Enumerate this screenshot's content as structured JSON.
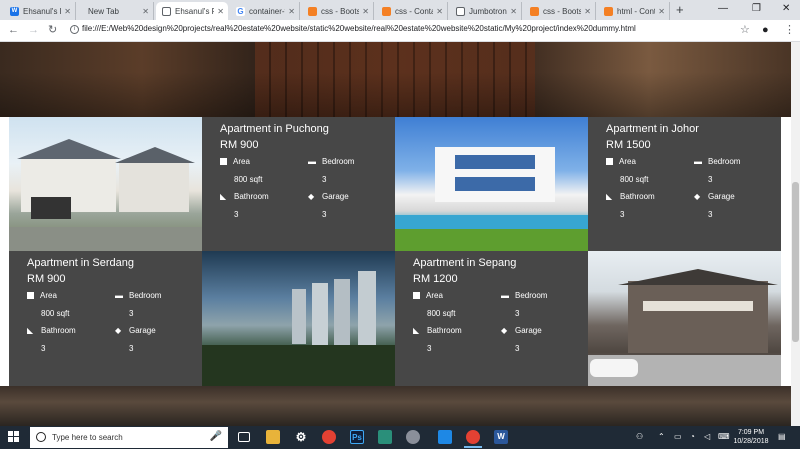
{
  "browser": {
    "tabs": [
      {
        "label": "Ehsanul's R",
        "active": false,
        "favicon": "pdf-icon"
      },
      {
        "label": "New Tab",
        "active": false,
        "favicon": "none"
      },
      {
        "label": "Ehsanul's R",
        "active": true,
        "favicon": "page-icon"
      },
      {
        "label": "container-f",
        "active": false,
        "favicon": "google-icon"
      },
      {
        "label": "css - Bootst",
        "active": false,
        "favicon": "stackoverflow-icon"
      },
      {
        "label": "css - Conta",
        "active": false,
        "favicon": "stackoverflow-icon"
      },
      {
        "label": "Jumbotron",
        "active": false,
        "favicon": "page-icon"
      },
      {
        "label": "css - Boots",
        "active": false,
        "favicon": "stackoverflow-icon"
      },
      {
        "label": "html - Cont",
        "active": false,
        "favicon": "stackoverflow-icon"
      }
    ],
    "new_tab": "+",
    "window_controls": {
      "minimize": "—",
      "restore": "❐",
      "close": "✕"
    },
    "nav": {
      "back": "←",
      "forward": "→",
      "reload": "↻"
    },
    "url": "file:///E:/Web%20design%20projects/real%20estate%20website/static%20website/real%20estate%20website%20static/My%20project/index%20dummy.html",
    "bookmark": "☆",
    "profile": "●",
    "menu": "⋮"
  },
  "listings": [
    {
      "title": "Apartment in Puchong",
      "price": "RM 900",
      "area_label": "Area",
      "area_value": "800 sqft",
      "bedroom_label": "Bedroom",
      "bedroom_value": "3",
      "bathroom_label": "Bathroom",
      "bathroom_value": "3",
      "garage_label": "Garage",
      "garage_value": "3"
    },
    {
      "title": "Apartment in Johor",
      "price": "RM 1500",
      "area_label": "Area",
      "area_value": "800 sqft",
      "bedroom_label": "Bedroom",
      "bedroom_value": "3",
      "bathroom_label": "Bathroom",
      "bathroom_value": "3",
      "garage_label": "Garage",
      "garage_value": "3"
    },
    {
      "title": "Apartment in Serdang",
      "price": "RM 900",
      "area_label": "Area",
      "area_value": "800 sqft",
      "bedroom_label": "Bedroom",
      "bedroom_value": "3",
      "bathroom_label": "Bathroom",
      "bathroom_value": "3",
      "garage_label": "Garage",
      "garage_value": "3"
    },
    {
      "title": "Apartment in Sepang",
      "price": "RM 1200",
      "area_label": "Area",
      "area_value": "800 sqft",
      "bedroom_label": "Bedroom",
      "bedroom_value": "3",
      "bathroom_label": "Bathroom",
      "bathroom_value": "3",
      "garage_label": "Garage",
      "garage_value": "3"
    }
  ],
  "icons": {
    "area": "checkbox-icon",
    "bedroom": "bed-icon",
    "bathroom": "bathtub-icon",
    "garage": "car-icon"
  },
  "colors": {
    "card_bg": "#474747",
    "card_text": "#ffffff",
    "taskbar": "#1f2a36"
  },
  "taskbar": {
    "search_placeholder": "Type here to search",
    "time": "7:09 PM",
    "date": "10/28/2018"
  }
}
